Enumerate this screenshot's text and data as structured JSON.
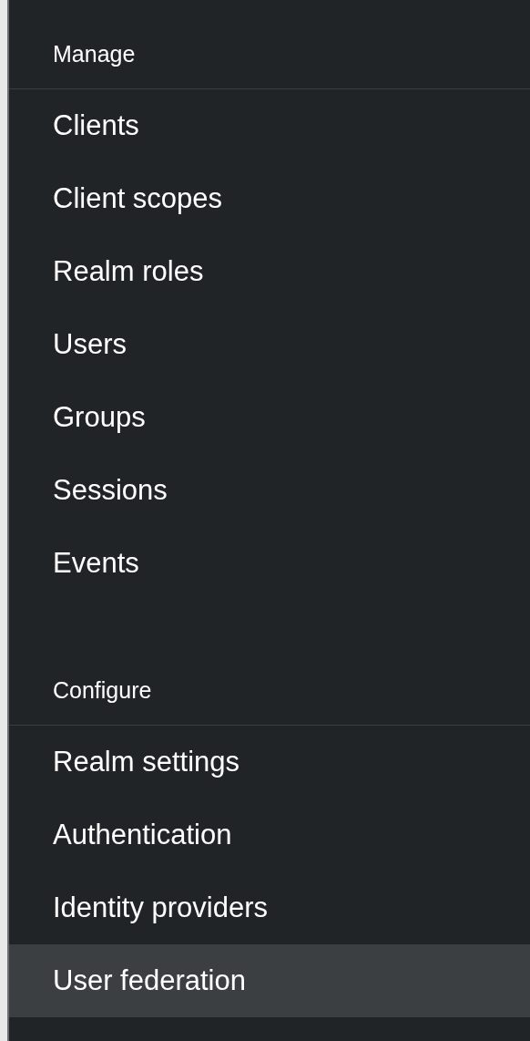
{
  "sections": [
    {
      "title": "Manage",
      "items": [
        {
          "label": "Clients",
          "selected": false
        },
        {
          "label": "Client scopes",
          "selected": false
        },
        {
          "label": "Realm roles",
          "selected": false
        },
        {
          "label": "Users",
          "selected": false
        },
        {
          "label": "Groups",
          "selected": false
        },
        {
          "label": "Sessions",
          "selected": false
        },
        {
          "label": "Events",
          "selected": false
        }
      ]
    },
    {
      "title": "Configure",
      "items": [
        {
          "label": "Realm settings",
          "selected": false
        },
        {
          "label": "Authentication",
          "selected": false
        },
        {
          "label": "Identity providers",
          "selected": false
        },
        {
          "label": "User federation",
          "selected": true
        }
      ]
    }
  ]
}
